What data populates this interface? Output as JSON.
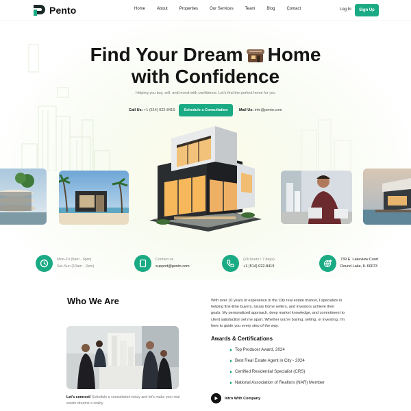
{
  "brand": {
    "name": "Pento",
    "accent": "#1aaa84",
    "dark": "#111111"
  },
  "nav": {
    "items": [
      "Home",
      "About",
      "Properties",
      "Our Services",
      "Team",
      "Blog",
      "Contact"
    ],
    "login": "Log In",
    "signup": "Sign Up"
  },
  "hero": {
    "title_line1_a": "Find Your Dream",
    "title_line1_b": "Home",
    "title_line2": "with Confidence",
    "subtitle": "Helping you buy, sell, and invest with confidence. Let's find the perfect home for you",
    "call_label": "Call Us:",
    "call_value": "+1 (514) 022-8419",
    "cta_button": "Schedule a Consultation",
    "mail_label": "Mail Us:",
    "mail_value": "info@pento.com"
  },
  "contact_bar": {
    "hours": {
      "line1": "Mon-Fri (8am - 6pm)",
      "line2": "Sat-Sun (10am - 2pm)",
      "icon": "clock-icon"
    },
    "email": {
      "line1": "Contact us",
      "line2": "support@pento.com",
      "icon": "notebook-icon"
    },
    "phone": {
      "line1": "(24 hours / 7 days)",
      "line2": "+1 (514) 022-8419",
      "icon": "phone-icon"
    },
    "address": {
      "line1": "739 E. Lakeview Court",
      "line2": "Round Lake, IL 60073",
      "icon": "globe-pin-icon"
    }
  },
  "who": {
    "title": "Who We Are",
    "paragraph": "With over 10 years of experience in the City real estate market, I specialize in helping first-time buyers, luxury home sellers, and investors achieve their goals. My personalized approach, deep market knowledge, and commitment to client satisfaction set me apart. Whether you're buying, selling, or investing, I'm here to guide you every step of the way.",
    "connect_bold": "Let's connect!",
    "connect_text": " Schedule a consultation today and let's make your real estate dreams a reality",
    "awards_title": "Awards & Certifications",
    "awards": [
      "Top Producer Award, 2024",
      "Best Real Estate Agent in City - 2024",
      "Certified Residential Specialist (CRS)",
      "National Association of Realtors (NAR) Member"
    ],
    "intro_label": "Intro With Company"
  }
}
